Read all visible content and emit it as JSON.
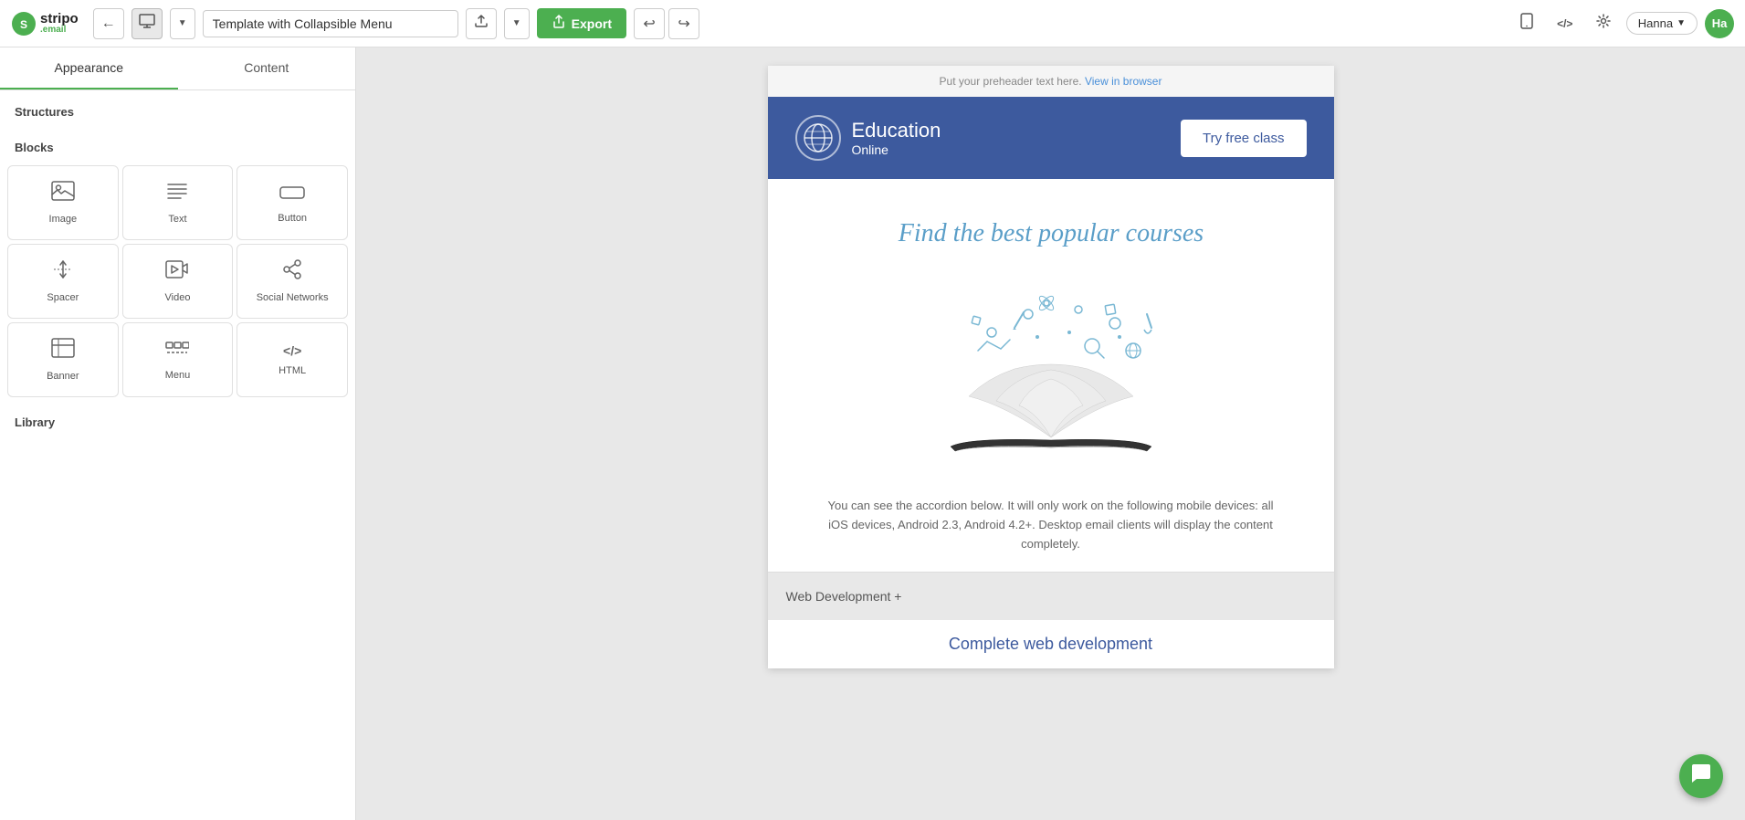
{
  "app": {
    "logo_main": "stripo",
    "logo_sub": ".email"
  },
  "topbar": {
    "back_icon": "←",
    "desktop_icon": "▣",
    "dropdown_icon": "▾",
    "template_name": "Template with Collapsible Menu",
    "upload_icon": "↑",
    "export_label": "Export",
    "export_icon": "⬡",
    "undo_icon": "↩",
    "redo_icon": "↪",
    "mobile_icon": "📱",
    "code_icon": "</>",
    "settings_icon": "⚙",
    "user_name": "Hanna",
    "user_dropdown": "▾",
    "avatar_text": "Ha"
  },
  "left_panel": {
    "tab_appearance": "Appearance",
    "tab_content": "Content",
    "section_structures": "Structures",
    "section_blocks": "Blocks",
    "section_library": "Library",
    "blocks": [
      {
        "id": "image",
        "icon": "🖼",
        "label": "Image"
      },
      {
        "id": "text",
        "icon": "≡",
        "label": "Text"
      },
      {
        "id": "button",
        "icon": "⬜",
        "label": "Button"
      },
      {
        "id": "spacer",
        "icon": "✛",
        "label": "Spacer"
      },
      {
        "id": "video",
        "icon": "▶",
        "label": "Video"
      },
      {
        "id": "social-networks",
        "icon": "◁",
        "label": "Social Networks"
      },
      {
        "id": "banner",
        "icon": "▦",
        "label": "Banner"
      },
      {
        "id": "menu",
        "icon": "▬▬",
        "label": "Menu"
      },
      {
        "id": "html",
        "icon": "</>",
        "label": "HTML"
      }
    ]
  },
  "email_preview": {
    "preheader_text": "Put your preheader text here.",
    "view_in_browser": "View in browser",
    "header_bg": "#3d5a9e",
    "logo_title": "Education",
    "logo_sub": "Online",
    "try_btn_label": "Try free class",
    "find_courses_text": "Find the best popular courses",
    "accordion_text": "You can see the accordion below. It will only work on the following mobile devices: all iOS devices, Android 2.3, Android 4.2+. Desktop email clients will display the content completely.",
    "accordion_row_label": "Web Development +",
    "complete_web_label": "Complete web development"
  },
  "chat": {
    "icon": "💬"
  }
}
